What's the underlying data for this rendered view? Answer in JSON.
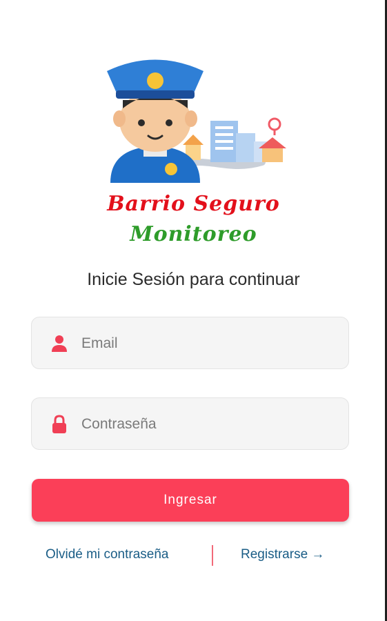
{
  "app": {
    "logo_line1": "Barrio Seguro",
    "logo_line2": "Monitoreo",
    "colors": {
      "accent": "#fb3f58",
      "link": "#1a5d86",
      "logo_red": "#e3101b",
      "logo_green": "#2e9c2a"
    }
  },
  "form": {
    "subtitle": "Inicie Sesión para continuar",
    "email": {
      "placeholder": "Email",
      "value": "",
      "icon": "user-icon"
    },
    "password": {
      "placeholder": "Contraseña",
      "value": "",
      "icon": "lock-icon"
    },
    "submit_label": "Ingresar"
  },
  "links": {
    "forgot": "Olvidé mi contraseña",
    "register": "Registrarse →"
  }
}
